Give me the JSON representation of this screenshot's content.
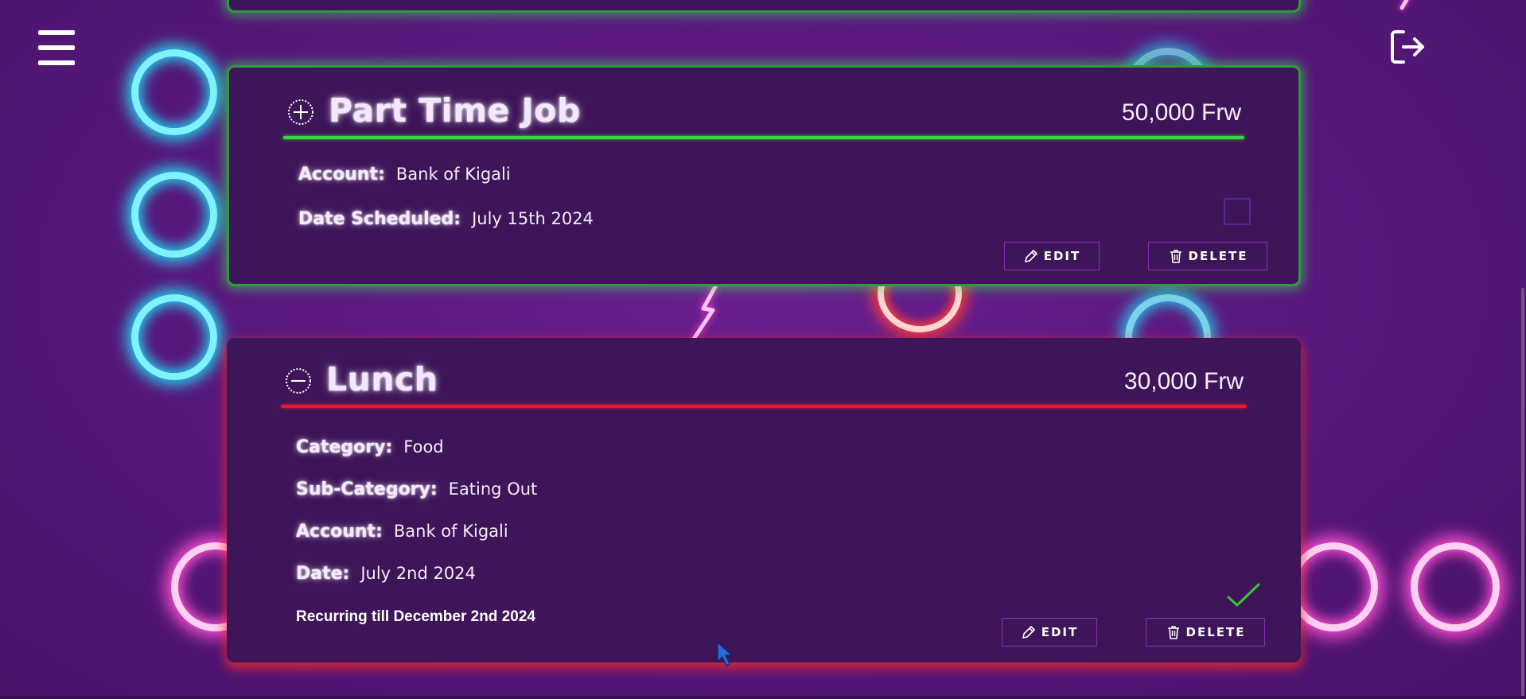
{
  "colors": {
    "background": "#5a1a7e",
    "card": "#3e1559",
    "income_accent": "#38d43f",
    "expense_accent": "#e8182e",
    "button_border": "#8c2fb4"
  },
  "header": {
    "menu_icon": "hamburger-menu-icon",
    "logout_icon": "logout-icon"
  },
  "transactions": [
    {
      "type": "income",
      "type_icon": "plus-circle-icon",
      "title": "Part Time Job",
      "amount": "50,000 Frw",
      "fields": [
        {
          "label": "Account:",
          "value": "Bank of Kigali"
        },
        {
          "label": "Date Scheduled:",
          "value": "July 15th 2024"
        }
      ],
      "completed": false,
      "edit_label": "EDIT",
      "delete_label": "DELETE"
    },
    {
      "type": "expense",
      "type_icon": "minus-circle-icon",
      "title": "Lunch",
      "amount": "30,000 Frw",
      "fields": [
        {
          "label": "Category:",
          "value": "Food"
        },
        {
          "label": "Sub-Category:",
          "value": "Eating Out"
        },
        {
          "label": "Account:",
          "value": "Bank of Kigali"
        },
        {
          "label": "Date:",
          "value": "July 2nd 2024"
        }
      ],
      "recurring": "Recurring till December 2nd 2024",
      "completed": true,
      "edit_label": "EDIT",
      "delete_label": "DELETE"
    }
  ]
}
